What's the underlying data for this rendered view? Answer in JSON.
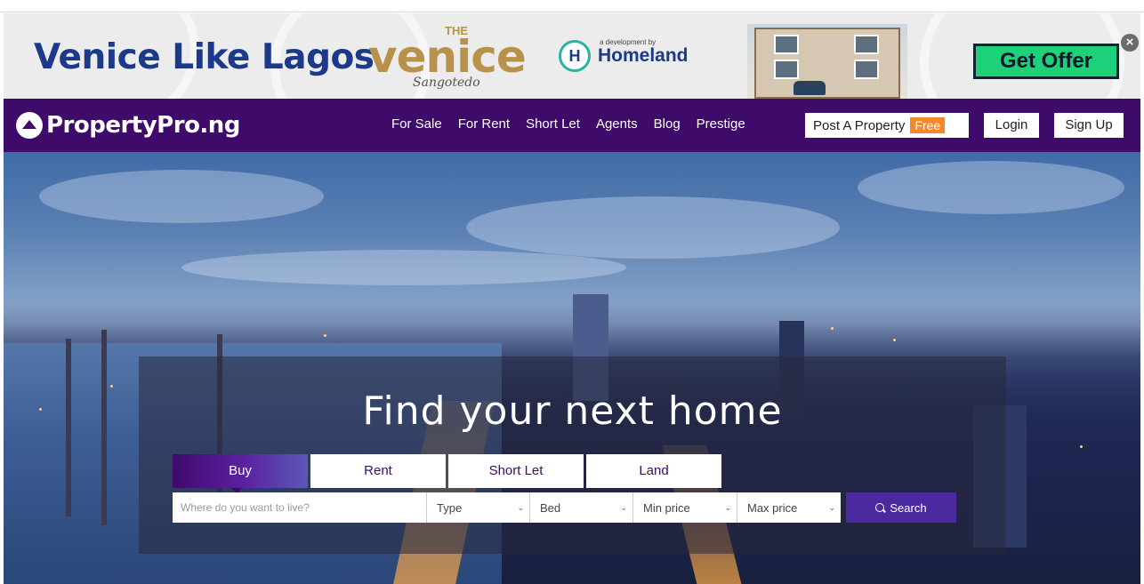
{
  "ad": {
    "headline": "Venice Like Lagos",
    "logo_the": "THE",
    "logo_main": "venice",
    "logo_sub": "Sangotedo",
    "developer_note": "a development by",
    "developer_name": "Homeland",
    "developer_mark": "H",
    "cta": "Get Offer",
    "close": "×"
  },
  "nav": {
    "brand": "PropertyPro.ng",
    "links": [
      "For Sale",
      "For Rent",
      "Short Let",
      "Agents",
      "Blog",
      "Prestige"
    ],
    "post_label": "Post A Property",
    "post_badge": "Free",
    "login": "Login",
    "signup": "Sign Up"
  },
  "hero": {
    "title": "Find your next home",
    "tabs": [
      "Buy",
      "Rent",
      "Short Let",
      "Land"
    ],
    "active_tab": "Buy",
    "search": {
      "placeholder": "Where do you want to live?",
      "type": "Type",
      "bed": "Bed",
      "min_price": "Min price",
      "max_price": "Max price",
      "button": "Search"
    }
  },
  "colors": {
    "brand_purple": "#3e0b6a",
    "badge_orange": "#f4892a",
    "offer_green": "#1fd07a",
    "search_button": "#4b2aa0"
  }
}
